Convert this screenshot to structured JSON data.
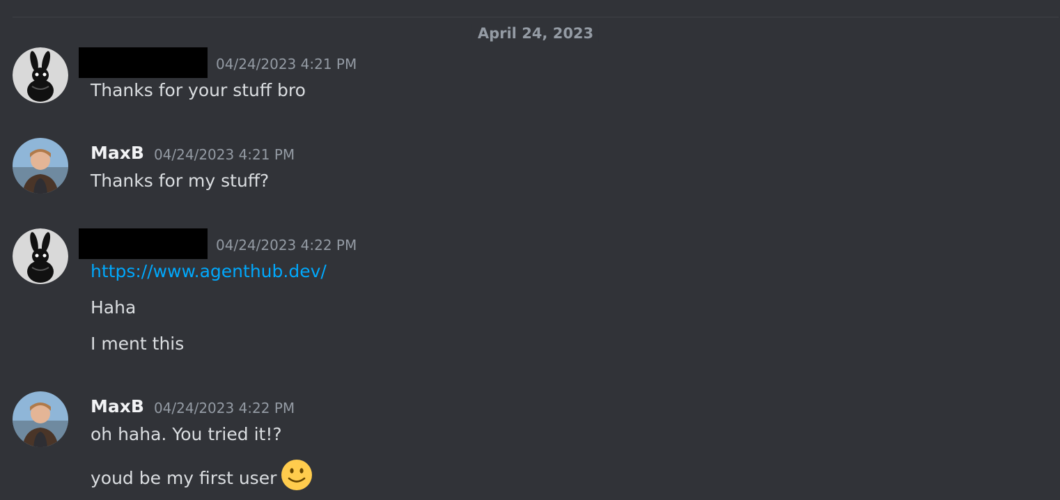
{
  "divider": {
    "date": "April 24, 2023"
  },
  "messages": [
    {
      "author": "",
      "author_redacted": true,
      "avatar": "bunny-avatar-icon",
      "timestamp": "04/24/2023 4:21 PM",
      "lines": [
        "Thanks for your stuff bro"
      ]
    },
    {
      "author": "MaxB",
      "author_redacted": false,
      "avatar": "maxb-photo-avatar",
      "timestamp": "04/24/2023 4:21 PM",
      "lines": [
        "Thanks for my stuff?"
      ]
    },
    {
      "author": "",
      "author_redacted": true,
      "avatar": "bunny-avatar-icon",
      "timestamp": "04/24/2023 4:22 PM",
      "lines": [
        "https://www.agenthub.dev/",
        "Haha",
        "I ment this"
      ]
    },
    {
      "author": "MaxB",
      "author_redacted": false,
      "avatar": "maxb-photo-avatar",
      "timestamp": "04/24/2023 4:22 PM",
      "lines": [
        "oh haha. You tried it!?",
        "youd be my first user"
      ],
      "emoji": "slightly-smiling-face-icon"
    }
  ],
  "colors": {
    "background": "#313338",
    "text": "#dbdee1",
    "muted": "#949ba4",
    "link": "#00a8fc",
    "redaction": "#000000"
  }
}
